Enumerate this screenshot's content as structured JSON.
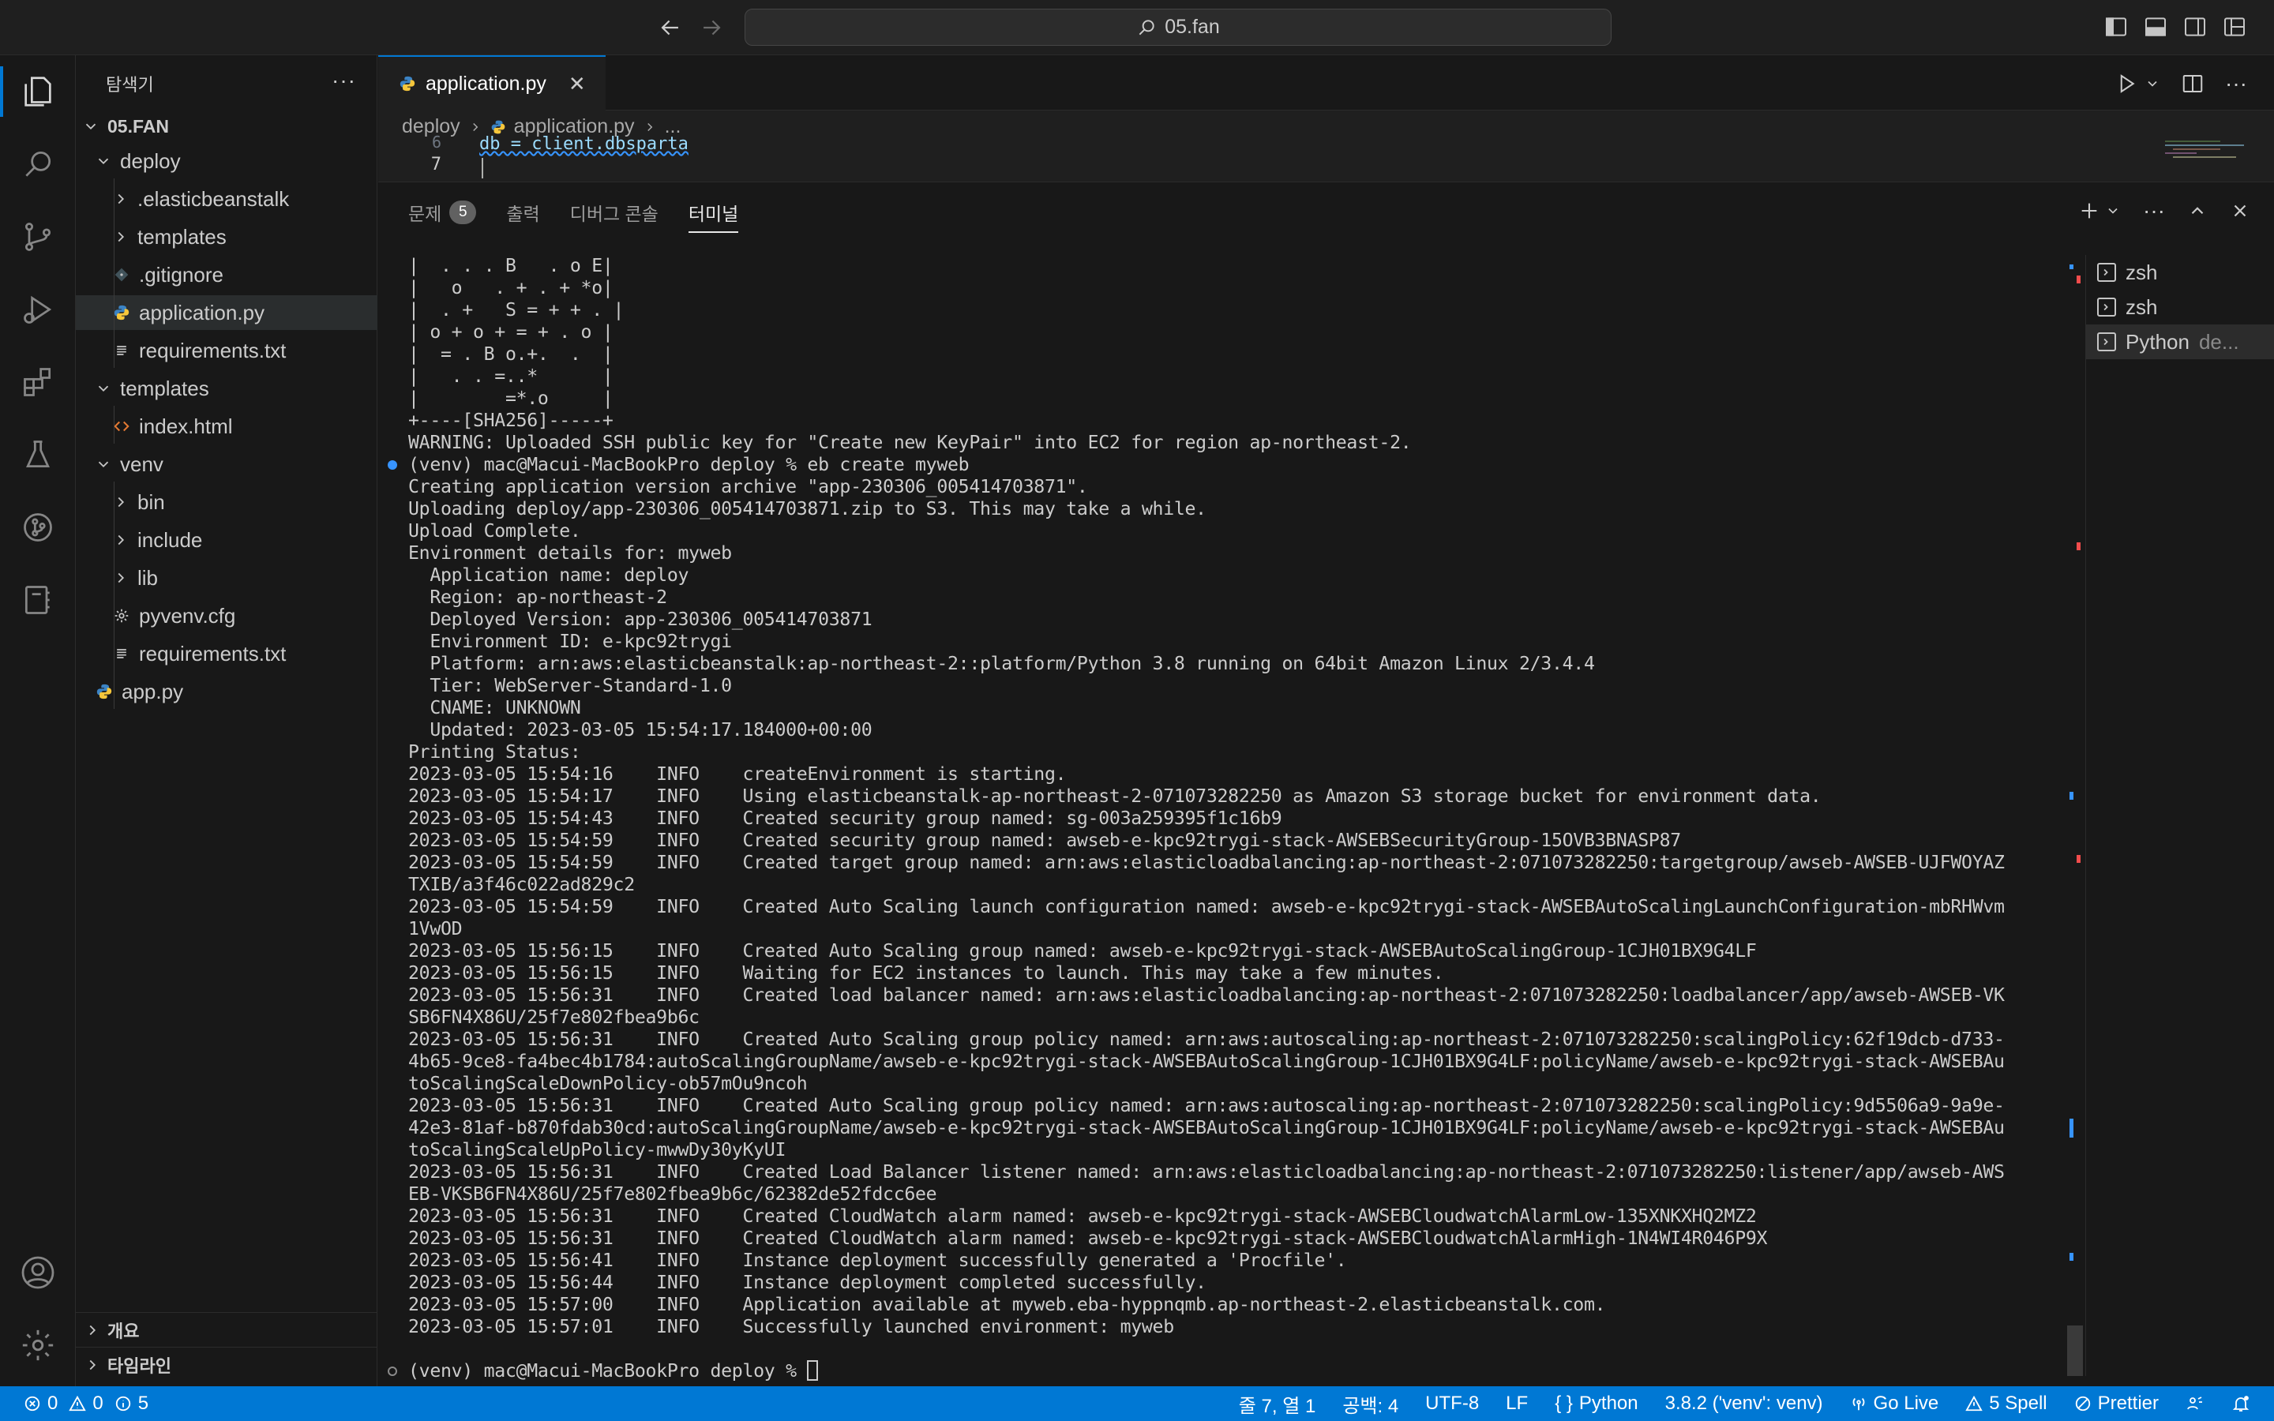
{
  "titlebar": {
    "search_text": "05.fan"
  },
  "sidebar": {
    "title": "탐색기",
    "more": "···",
    "root": "05.FAN",
    "items": [
      {
        "label": "deploy",
        "type": "folder-open",
        "depth": 1
      },
      {
        "label": ".elasticbeanstalk",
        "type": "folder",
        "depth": 2
      },
      {
        "label": "templates",
        "type": "folder",
        "depth": 2
      },
      {
        "label": ".gitignore",
        "type": "git",
        "depth": 2
      },
      {
        "label": "application.py",
        "type": "python",
        "depth": 2
      },
      {
        "label": "requirements.txt",
        "type": "text",
        "depth": 2
      },
      {
        "label": "templates",
        "type": "folder-open",
        "depth": 1
      },
      {
        "label": "index.html",
        "type": "html",
        "depth": 2
      },
      {
        "label": "venv",
        "type": "folder-open",
        "depth": 1
      },
      {
        "label": "bin",
        "type": "folder",
        "depth": 2
      },
      {
        "label": "include",
        "type": "folder",
        "depth": 2
      },
      {
        "label": "lib",
        "type": "folder",
        "depth": 2
      },
      {
        "label": "pyvenv.cfg",
        "type": "gear",
        "depth": 2
      },
      {
        "label": "requirements.txt",
        "type": "text",
        "depth": 2
      },
      {
        "label": "app.py",
        "type": "python",
        "depth": 1
      }
    ],
    "outline": "개요",
    "timeline": "타임라인"
  },
  "editor": {
    "tab_label": "application.py",
    "tab_close": "✕",
    "breadcrumb": [
      "deploy",
      "application.py",
      "..."
    ],
    "line_prev_number": "6",
    "line_prev_text": "db = client.dbsparta",
    "line_number": "7"
  },
  "panel": {
    "tabs": [
      {
        "label": "문제",
        "badge": "5"
      },
      {
        "label": "출력"
      },
      {
        "label": "디버그 콘솔"
      },
      {
        "label": "터미널"
      }
    ],
    "terminals": [
      {
        "name": "zsh",
        "extra": ""
      },
      {
        "name": "zsh",
        "extra": ""
      },
      {
        "name": "Python",
        "extra": "de..."
      }
    ]
  },
  "terminal": {
    "lines": [
      "|  . . . B   . o E|",
      "|   o   . + . + *o|",
      "|  . +   S = + + . |",
      "| o + o + = + . o |",
      "|  = . B o.+.  .  |",
      "|   . . =..*      |",
      "|        =*.o     |",
      "+----[SHA256]-----+",
      "WARNING: Uploaded SSH public key for \"Create new KeyPair\" into EC2 for region ap-northeast-2.",
      "(venv) mac@Macui-MacBookPro deploy % eb create myweb",
      "Creating application version archive \"app-230306_005414703871\".",
      "Uploading deploy/app-230306_005414703871.zip to S3. This may take a while.",
      "Upload Complete.",
      "Environment details for: myweb",
      "  Application name: deploy",
      "  Region: ap-northeast-2",
      "  Deployed Version: app-230306_005414703871",
      "  Environment ID: e-kpc92trygi",
      "  Platform: arn:aws:elasticbeanstalk:ap-northeast-2::platform/Python 3.8 running on 64bit Amazon Linux 2/3.4.4",
      "  Tier: WebServer-Standard-1.0",
      "  CNAME: UNKNOWN",
      "  Updated: 2023-03-05 15:54:17.184000+00:00",
      "Printing Status:",
      "2023-03-05 15:54:16    INFO    createEnvironment is starting.",
      "2023-03-05 15:54:17    INFO    Using elasticbeanstalk-ap-northeast-2-071073282250 as Amazon S3 storage bucket for environment data.",
      "2023-03-05 15:54:43    INFO    Created security group named: sg-003a259395f1c16b9",
      "2023-03-05 15:54:59    INFO    Created security group named: awseb-e-kpc92trygi-stack-AWSEBSecurityGroup-15OVB3BNASP87",
      "2023-03-05 15:54:59    INFO    Created target group named: arn:aws:elasticloadbalancing:ap-northeast-2:071073282250:targetgroup/awseb-AWSEB-UJFWOYAZ",
      "TXIB/a3f46c022ad829c2",
      "2023-03-05 15:54:59    INFO    Created Auto Scaling launch configuration named: awseb-e-kpc92trygi-stack-AWSEBAutoScalingLaunchConfiguration-mbRHWvm",
      "1VwOD",
      "2023-03-05 15:56:15    INFO    Created Auto Scaling group named: awseb-e-kpc92trygi-stack-AWSEBAutoScalingGroup-1CJH01BX9G4LF",
      "2023-03-05 15:56:15    INFO    Waiting for EC2 instances to launch. This may take a few minutes.",
      "2023-03-05 15:56:31    INFO    Created load balancer named: arn:aws:elasticloadbalancing:ap-northeast-2:071073282250:loadbalancer/app/awseb-AWSEB-VK",
      "SB6FN4X86U/25f7e802fbea9b6c",
      "2023-03-05 15:56:31    INFO    Created Auto Scaling group policy named: arn:aws:autoscaling:ap-northeast-2:071073282250:scalingPolicy:62f19dcb-d733-",
      "4b65-9ce8-fa4bec4b1784:autoScalingGroupName/awseb-e-kpc92trygi-stack-AWSEBAutoScalingGroup-1CJH01BX9G4LF:policyName/awseb-e-kpc92trygi-stack-AWSEBAu",
      "toScalingScaleDownPolicy-ob57mOu9ncoh",
      "2023-03-05 15:56:31    INFO    Created Auto Scaling group policy named: arn:aws:autoscaling:ap-northeast-2:071073282250:scalingPolicy:9d5506a9-9a9e-",
      "42e3-81af-b870fdab30cd:autoScalingGroupName/awseb-e-kpc92trygi-stack-AWSEBAutoScalingGroup-1CJH01BX9G4LF:policyName/awseb-e-kpc92trygi-stack-AWSEBAu",
      "toScalingScaleUpPolicy-mwwDy30yKyUI",
      "2023-03-05 15:56:31    INFO    Created Load Balancer listener named: arn:aws:elasticloadbalancing:ap-northeast-2:071073282250:listener/app/awseb-AWS",
      "EB-VKSB6FN4X86U/25f7e802fbea9b6c/62382de52fdcc6ee",
      "2023-03-05 15:56:31    INFO    Created CloudWatch alarm named: awseb-e-kpc92trygi-stack-AWSEBCloudwatchAlarmLow-135XNKXHQ2MZ2",
      "2023-03-05 15:56:31    INFO    Created CloudWatch alarm named: awseb-e-kpc92trygi-stack-AWSEBCloudwatchAlarmHigh-1N4WI4R046P9X",
      "2023-03-05 15:56:41    INFO    Instance deployment successfully generated a 'Procfile'.",
      "2023-03-05 15:56:44    INFO    Instance deployment completed successfully.",
      "2023-03-05 15:57:00    INFO    Application available at myweb.eba-hyppnqmb.ap-northeast-2.elasticbeanstalk.com.",
      "2023-03-05 15:57:01    INFO    Successfully launched environment: myweb",
      ""
    ],
    "prompt": "(venv) mac@Macui-MacBookPro deploy % "
  },
  "statusbar": {
    "errors": "0",
    "warnings": "0",
    "infos": "5",
    "position": "줄 7, 열 1",
    "spaces": "공백: 4",
    "encoding": "UTF-8",
    "eol": "LF",
    "language": "Python",
    "interpreter": "3.8.2 ('venv': venv)",
    "golive": "Go Live",
    "spell": "5 Spell",
    "prettier": "Prettier"
  },
  "colors": {
    "accent": "#0078d4",
    "background": "#181818",
    "editor_bg": "#1f1f1f"
  }
}
